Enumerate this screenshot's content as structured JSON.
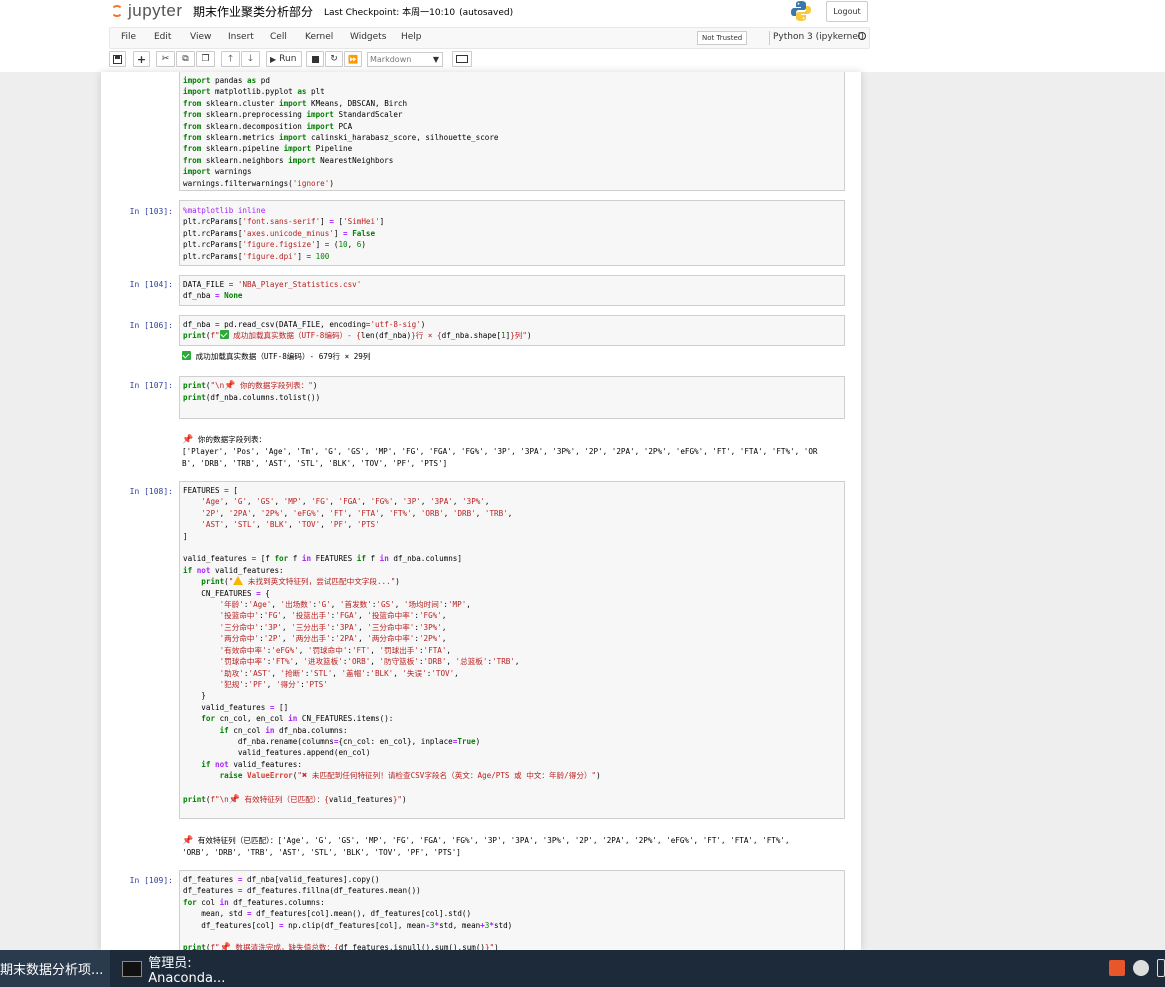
{
  "header": {
    "logo_text": "jupyter",
    "notebook_name": "期末作业聚类分析部分",
    "checkpoint": "Last Checkpoint: 本周一10:10",
    "autosave": "(autosaved)",
    "logout_label": "Logout"
  },
  "menu": {
    "items": [
      "File",
      "Edit",
      "View",
      "Insert",
      "Cell",
      "Kernel",
      "Widgets",
      "Help"
    ],
    "trusted_label": "Not Trusted",
    "kernel_label": "Python 3 (ipykernel)"
  },
  "toolbar": {
    "run_label": "Run",
    "cell_type": "Markdown"
  },
  "cells": [
    {
      "prompt": "",
      "lines": [
        "import pandas as pd",
        "import matplotlib.pyplot as plt",
        "from sklearn.cluster import KMeans, DBSCAN, Birch",
        "from sklearn.preprocessing import StandardScaler",
        "from sklearn.decomposition import PCA",
        "from sklearn.metrics import calinski_harabasz_score, silhouette_score",
        "from sklearn.pipeline import Pipeline",
        "from sklearn.neighbors import NearestNeighbors",
        "import warnings",
        "warnings.filterwarnings('ignore')"
      ]
    },
    {
      "prompt": "In  [103]:",
      "lines": [
        "%matplotlib inline",
        "plt.rcParams['font.sans-serif'] = ['SimHei']",
        "plt.rcParams['axes.unicode_minus'] = False",
        "plt.rcParams['figure.figsize'] = (10, 6)",
        "plt.rcParams['figure.dpi'] = 100"
      ]
    },
    {
      "prompt": "In  [104]:",
      "lines": [
        "DATA_FILE = 'NBA_Player_Statistics.csv'",
        "df_nba = None"
      ]
    },
    {
      "prompt": "In  [106]:",
      "lines": [
        "df_nba = pd.read_csv(DATA_FILE, encoding='utf-8-sig')",
        "print(f\"✅ 成功加载真实数据（UTF-8编码）- {len(df_nba)}行 × {df_nba.shape[1]}列\")"
      ],
      "output": [
        "✅ 成功加载真实数据（UTF-8编码）- 679行 × 29列"
      ]
    },
    {
      "prompt": "In  [107]:",
      "lines": [
        "print(\"\\n📌 你的数据字段列表：\")",
        "print(df_nba.columns.tolist())"
      ],
      "output": [
        "📌 你的数据字段列表：",
        "['Player', 'Pos', 'Age', 'Tm', 'G', 'GS', 'MP', 'FG', 'FGA', 'FG%', '3P', '3PA', '3P%', '2P', '2PA', '2P%', 'eFG%', 'FT', 'FTA', 'FT%', 'OR",
        "B', 'DRB', 'TRB', 'AST', 'STL', 'BLK', 'TOV', 'PF', 'PTS']"
      ]
    },
    {
      "prompt": "In  [108]:",
      "lines": [
        "FEATURES = [",
        "    'Age', 'G', 'GS', 'MP', 'FG', 'FGA', 'FG%', '3P', '3PA', '3P%',",
        "    '2P', '2PA', '2P%', 'eFG%', 'FT', 'FTA', 'FT%', 'ORB', 'DRB', 'TRB',",
        "    'AST', 'STL', 'BLK', 'TOV', 'PF', 'PTS'",
        "]",
        "",
        "valid_features = [f for f in FEATURES if f in df_nba.columns]",
        "if not valid_features:",
        "    print(\"⚠️ 未找到英文特征列，尝试匹配中文字段...\")",
        "    CN_FEATURES = {",
        "        '年龄':'Age', '出场数':'G', '首发数':'GS', '场均时间':'MP',",
        "        '投篮命中':'FG', '投篮出手':'FGA', '投篮命中率':'FG%',",
        "        '三分命中':'3P', '三分出手':'3PA', '三分命中率':'3P%',",
        "        '两分命中':'2P', '两分出手':'2PA', '两分命中率':'2P%',",
        "        '有效命中率':'eFG%', '罚球命中':'FT', '罚球出手':'FTA',",
        "        '罚球命中率':'FT%', '进攻篮板':'ORB', '防守篮板':'DRB', '总篮板':'TRB',",
        "        '助攻':'AST', '抢断':'STL', '盖帽':'BLK', '失误':'TOV',",
        "        '犯规':'PF', '得分':'PTS'",
        "    }",
        "    valid_features = []",
        "    for cn_col, en_col in CN_FEATURES.items():",
        "        if cn_col in df_nba.columns:",
        "            df_nba.rename(columns={cn_col: en_col}, inplace=True)",
        "            valid_features.append(en_col)",
        "    if not valid_features:",
        "        raise ValueError(\"❌ 未匹配到任何特征列！请检查CSV字段名（英文：Age/PTS 或 中文：年龄/得分）\")",
        "",
        "print(f\"\\n📌 有效特征列（已匹配）：{valid_features}\")"
      ],
      "output": [
        "📌 有效特征列（已匹配）：['Age', 'G', 'GS', 'MP', 'FG', 'FGA', 'FG%', '3P', '3PA', '3P%', '2P', '2PA', '2P%', 'eFG%', 'FT', 'FTA', 'FT%',",
        "'ORB', 'DRB', 'TRB', 'AST', 'STL', 'BLK', 'TOV', 'PF', 'PTS']"
      ]
    },
    {
      "prompt": "In  [109]:",
      "lines": [
        "df_features = df_nba[valid_features].copy()",
        "df_features = df_features.fillna(df_features.mean())",
        "for col in df_features.columns:",
        "    mean, std = df_features[col].mean(), df_features[col].std()",
        "    df_features[col] = np.clip(df_features[col], mean-3*std, mean+3*std)",
        "",
        "print(f\"📌 数据清洗完成，缺失值总数：{df_features.isnull().sum().sum()}\")"
      ]
    }
  ],
  "taskbar": {
    "task1": "期末数据分析项...",
    "task2": "管理员: Anaconda..."
  }
}
